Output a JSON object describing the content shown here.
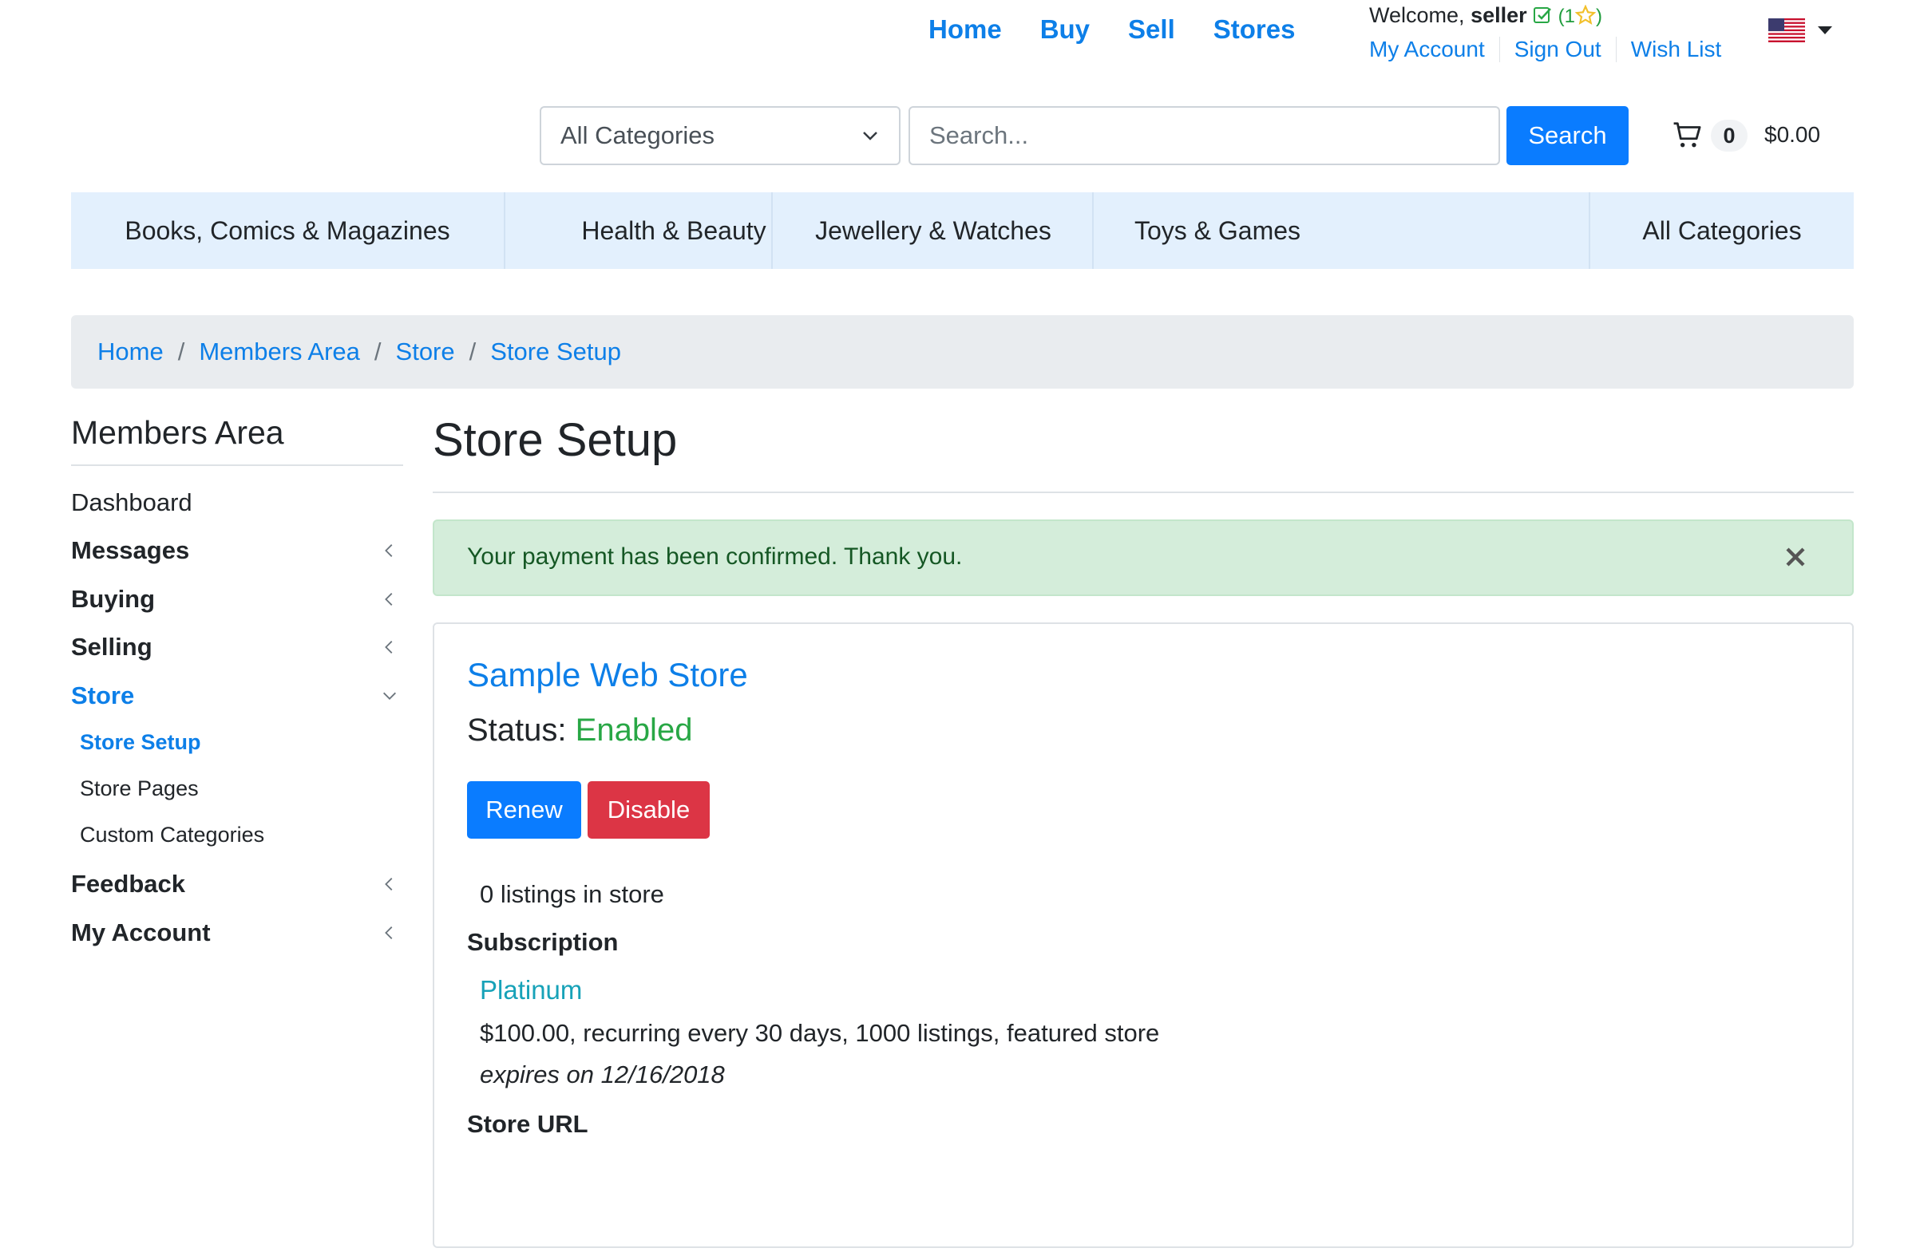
{
  "nav": {
    "links": [
      "Home",
      "Buy",
      "Sell",
      "Stores"
    ]
  },
  "user": {
    "welcome": "Welcome,",
    "name": "seller",
    "rating_open": "(1",
    "rating_close": ")",
    "links": [
      "My Account",
      "Sign Out",
      "Wish List"
    ],
    "icons": [
      "verified-check-icon",
      "star-icon",
      "us-flag-icon",
      "caret-down-icon"
    ]
  },
  "search": {
    "category": "All Categories",
    "placeholder": "Search...",
    "button": "Search"
  },
  "cart": {
    "count": "0",
    "total": "$0.00",
    "icon": "cart-icon"
  },
  "categories": [
    "Books, Comics & Magazines",
    "Health & Beauty",
    "Jewellery & Watches",
    "Toys & Games",
    "All Categories"
  ],
  "breadcrumb": [
    "Home",
    "Members Area",
    "Store",
    "Store Setup"
  ],
  "breadcrumb_separator": "/",
  "sidebar": {
    "title": "Members Area",
    "items": [
      "Dashboard",
      "Messages",
      "Buying",
      "Selling",
      "Store",
      "Feedback",
      "My Account"
    ],
    "store_subitems": [
      "Store Setup",
      "Store Pages",
      "Custom Categories"
    ]
  },
  "page": {
    "title": "Store Setup"
  },
  "alert": {
    "message": "Your payment has been confirmed. Thank you."
  },
  "store": {
    "name": "Sample Web Store",
    "status_label": "Status:",
    "status_value": "Enabled",
    "renew_label": "Renew",
    "disable_label": "Disable",
    "listings": "0 listings in store",
    "subscription_heading": "Subscription",
    "plan_name": "Platinum",
    "plan_details": "$100.00, recurring every 30 days, 1000 listings, featured store",
    "expires": "expires on 12/16/2018",
    "url_heading": "Store URL"
  },
  "colors": {
    "link": "#0d7fe8",
    "primary_button": "#0a7cff",
    "danger_button": "#dc3545",
    "status_enabled": "#28a745",
    "plan": "#17a2b8",
    "alert_bg": "#d4edda",
    "category_bar": "#e3f0fd"
  }
}
